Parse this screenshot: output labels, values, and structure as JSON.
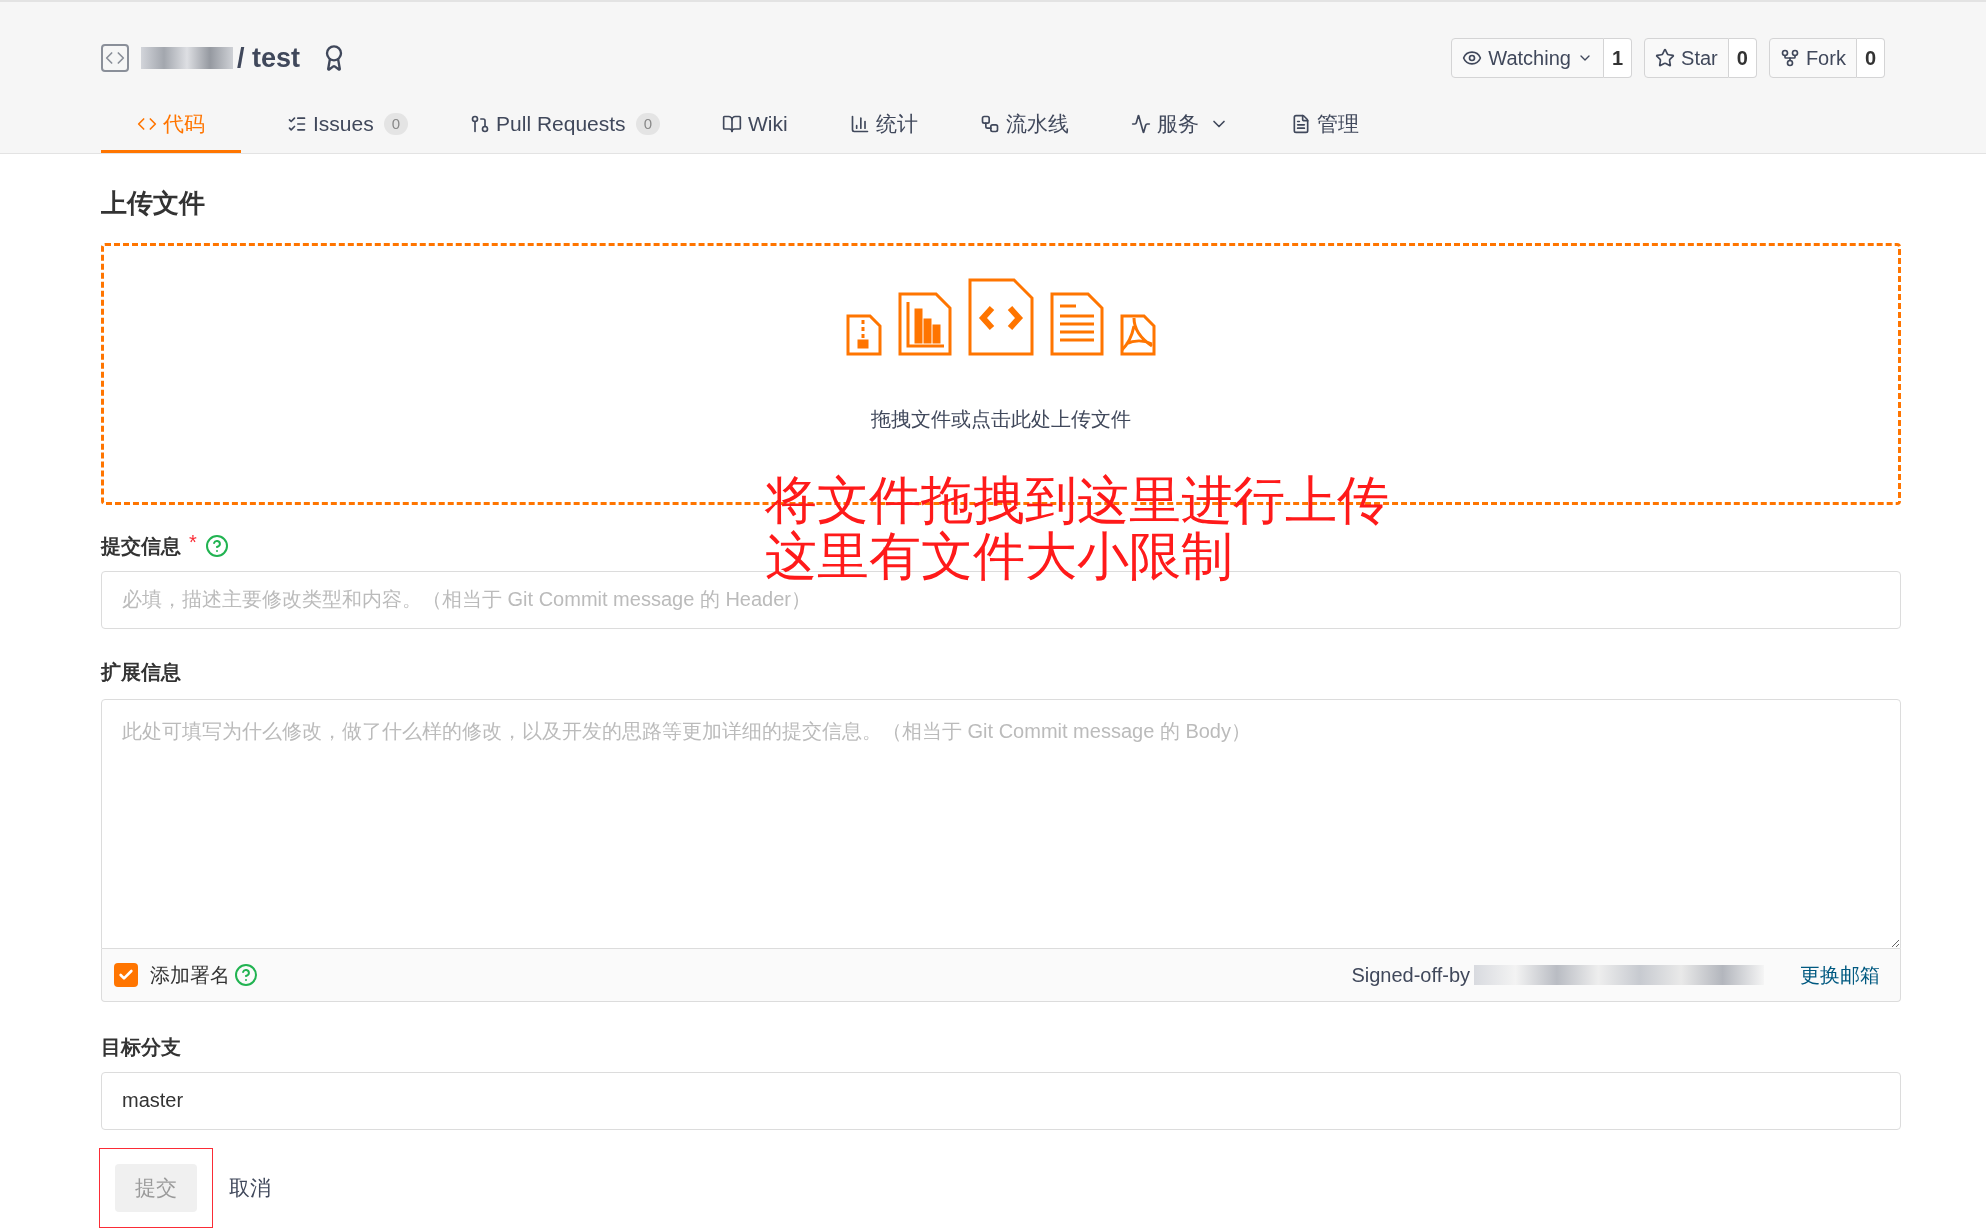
{
  "repo": {
    "name": "/ test"
  },
  "repo_actions": [
    {
      "label": "Watching",
      "count": "1",
      "kind": "watch"
    },
    {
      "label": "Star",
      "count": "0",
      "kind": "star"
    },
    {
      "label": "Fork",
      "count": "0",
      "kind": "fork"
    }
  ],
  "tabs": [
    {
      "label": "代码",
      "selected": true,
      "kind": "code"
    },
    {
      "label": "Issues",
      "count": "0",
      "selected": false,
      "kind": "issues"
    },
    {
      "label": "Pull Requests",
      "count": "0",
      "selected": false,
      "kind": "pr"
    },
    {
      "label": "Wiki",
      "selected": false,
      "kind": "wiki"
    },
    {
      "label": "统计",
      "selected": false,
      "kind": "stats"
    },
    {
      "label": "流水线",
      "selected": false,
      "kind": "pipeline"
    },
    {
      "label": "服务",
      "selected": false,
      "kind": "service"
    },
    {
      "label": "管理",
      "selected": false,
      "kind": "manage"
    }
  ],
  "page_title": "上传文件",
  "dropzone": {
    "hint": "拖拽文件或点击此处上传文件"
  },
  "commit_message": {
    "label": "提交信息",
    "required_mark": "*",
    "placeholder": "必填，描述主要修改类型和内容。（相当于 Git Commit message 的 Header）"
  },
  "extended_message": {
    "label": "扩展信息",
    "placeholder": "此处可填写为什么修改，做了什么样的修改，以及开发的思路等更加详细的提交信息。（相当于 Git Commit message 的 Body）"
  },
  "signature": {
    "label": "添加署名",
    "checked": true,
    "signed_off": "Signed-off-by",
    "change_email": "更换邮箱"
  },
  "target_branch": {
    "label": "目标分支",
    "value": "master"
  },
  "buttons": [
    {
      "label": "提交",
      "kind": "submit",
      "disabled": true
    },
    {
      "label": "取消",
      "kind": "cancel"
    }
  ],
  "annotation": {
    "lines": [
      "将文件拖拽到这里进行上传",
      "这里有文件大小限制"
    ]
  }
}
